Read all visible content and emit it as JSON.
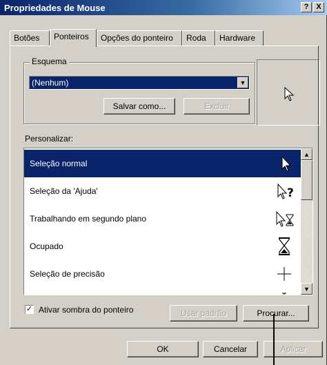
{
  "window": {
    "title": "Propriedades de Mouse",
    "help_button": "?",
    "close_button": "X"
  },
  "tabs": [
    {
      "label": "Botões"
    },
    {
      "label": "Ponteiros"
    },
    {
      "label": "Opções do ponteiro"
    },
    {
      "label": "Roda"
    },
    {
      "label": "Hardware"
    }
  ],
  "scheme": {
    "group_label": "Esquema",
    "selected_value": "(Nenhum)",
    "save_as_label": "Salvar como...",
    "delete_label": "Excluir"
  },
  "customize": {
    "label": "Personalizar:",
    "items": [
      {
        "label": "Seleção normal",
        "icon": "arrow-cursor-icon"
      },
      {
        "label": "Seleção da 'Ajuda'",
        "icon": "help-select-cursor-icon"
      },
      {
        "label": "Trabalhando em segundo plano",
        "icon": "working-background-cursor-icon"
      },
      {
        "label": "Ocupado",
        "icon": "hourglass-cursor-icon"
      },
      {
        "label": "Seleção de precisão",
        "icon": "crosshair-cursor-icon"
      },
      {
        "label": "",
        "icon": "text-select-cursor-icon"
      }
    ],
    "selected_index": 0
  },
  "shadow_checkbox": {
    "label": "Ativar sombra do ponteiro",
    "checked": true
  },
  "buttons": {
    "use_default": "Usar padrão",
    "browse": "Procurar...",
    "ok": "OK",
    "cancel": "Cancelar",
    "apply": "Aplicar"
  },
  "colors": {
    "selection": "#0a246a",
    "face": "#d4d0c8"
  }
}
